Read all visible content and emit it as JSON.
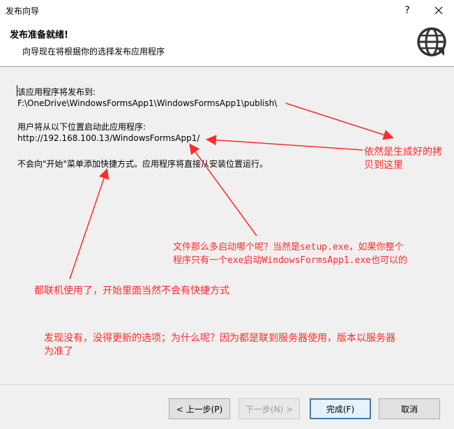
{
  "window": {
    "title": "发布向导",
    "help_glyph": "?",
    "close_icon": "close-icon"
  },
  "header": {
    "title": "发布准备就绪!",
    "subtitle": "向导现在将根据你的选择发布应用程序",
    "icon": "globe-publish-icon"
  },
  "content": {
    "publish_label": "该应用程序将发布到:",
    "publish_path": "F:\\OneDrive\\WindowsFormsApp1\\WindowsFormsApp1\\publish\\",
    "launch_label": "用户将从以下位置启动此应用程序:",
    "launch_url": "http://192.168.100.13/WindowsFormsApp1/",
    "shortcut_line": "不会向\"开始\"菜单添加快捷方式。应用程序将直接从安装位置运行。"
  },
  "annotations": {
    "note1_line1": "依然是生成好的拷",
    "note1_line2": "贝到这里",
    "note2_line1": "文件那么多启动哪个呢？当然是setup.exe，如果你整个",
    "note2_line2": "程序只有一个exe启动WindowsFormsApp1.exe也可以的",
    "note3": "都联机使用了，开始里面当然不会有快捷方式",
    "note4_line1": "发现没有，没得更新的选项；为什么呢？因为都是联到服务器使用，版本以服务器",
    "note4_line2": "为准了",
    "color": "#ff2a2a"
  },
  "buttons": {
    "prev": "< 上一步(P)",
    "next": "下一步(N) >",
    "finish": "完成(F)",
    "cancel": "取消"
  }
}
